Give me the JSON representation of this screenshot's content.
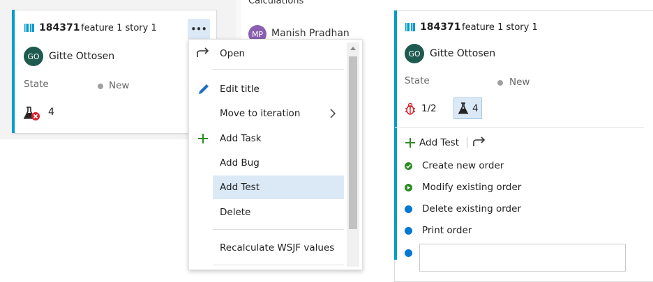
{
  "background_card": {
    "title_fragment": "Calculations",
    "assignee_initials": "MP",
    "assignee_name": "Manish Pradhan"
  },
  "card": {
    "id": "184371",
    "title": "feature 1 story 1",
    "assignee_initials": "GO",
    "assignee_name": "Gitte Ottosen",
    "state_label": "State",
    "state_value": "New",
    "test_count": "4",
    "more_label": "•••"
  },
  "context_menu": {
    "items": [
      {
        "label": "Open",
        "icon": "open-arrow-icon"
      },
      {
        "label": "Edit title",
        "icon": "pencil-icon"
      },
      {
        "label": "Move to iteration",
        "icon": "chevron-right-icon"
      },
      {
        "label": "Add Task",
        "icon": "plus-icon"
      },
      {
        "label": "Add Bug",
        "icon": "plus-icon"
      },
      {
        "label": "Add Test",
        "icon": "none"
      },
      {
        "label": "Delete",
        "icon": "none"
      },
      {
        "label": "Recalculate WSJF values",
        "icon": "none"
      }
    ],
    "highlighted": "Add Test"
  },
  "expanded_card": {
    "id": "184371",
    "title": "feature 1 story 1",
    "assignee_initials": "GO",
    "assignee_name": "Gitte Ottosen",
    "state_label": "State",
    "state_value": "New",
    "bug_count": "1/2",
    "test_count": "4",
    "add_test_label": "Add Test",
    "tests": [
      {
        "name": "Create new order",
        "status": "passed"
      },
      {
        "name": "Modify existing order",
        "status": "in-progress"
      },
      {
        "name": "Delete existing order",
        "status": "active"
      },
      {
        "name": "Print order",
        "status": "active"
      }
    ],
    "new_test_input_value": ""
  },
  "colors": {
    "accent": "#009ccc",
    "avatar_go": "#1e5a4f",
    "avatar_mp": "#8a5fb0",
    "passed": "#2e8b24",
    "active": "#0078d4",
    "highlight": "#dbe9f7",
    "bug_red": "#d9232b"
  }
}
